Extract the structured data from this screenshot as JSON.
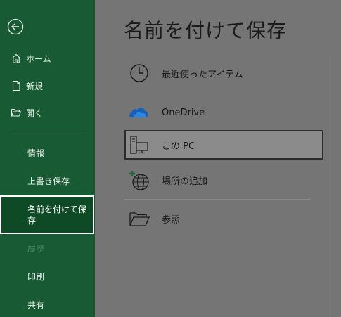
{
  "sidebar": {
    "items": [
      {
        "label": "ホーム",
        "icon": "home-icon"
      },
      {
        "label": "新規",
        "icon": "new-document-icon"
      },
      {
        "label": "開く",
        "icon": "open-folder-icon"
      },
      {
        "label": "情報"
      },
      {
        "label": "上書き保存"
      },
      {
        "label": "名前を付けて保存",
        "selected": true
      },
      {
        "label": "履歴",
        "disabled": true
      },
      {
        "label": "印刷"
      },
      {
        "label": "共有"
      }
    ],
    "accent": "#175a34"
  },
  "main": {
    "title": "名前を付けて保存",
    "locations": [
      {
        "label": "最近使ったアイテム",
        "icon": "clock-icon"
      },
      {
        "label": "OneDrive",
        "icon": "onedrive-cloud-icon"
      },
      {
        "label": "この PC",
        "icon": "this-pc-icon",
        "selected": true
      },
      {
        "label": "場所の追加",
        "icon": "add-place-globe-icon"
      },
      {
        "label": "参照",
        "icon": "browse-folder-icon"
      }
    ]
  }
}
